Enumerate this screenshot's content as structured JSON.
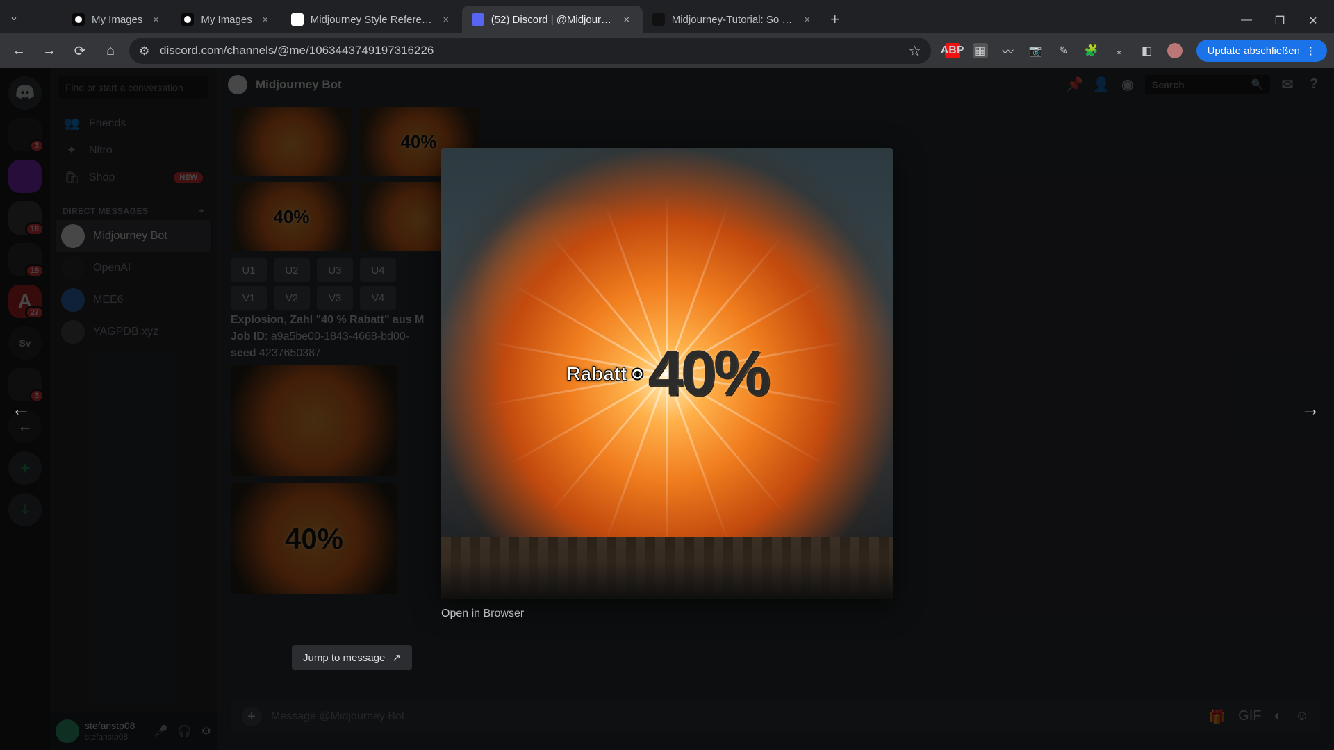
{
  "browser": {
    "tabs": [
      {
        "title": "My Images"
      },
      {
        "title": "My Images"
      },
      {
        "title": "Midjourney Style Reference"
      },
      {
        "title": "(52) Discord | @Midjourney Bot"
      },
      {
        "title": "Midjourney-Tutorial: So erstell"
      }
    ],
    "active_tab_index": 3,
    "url": "discord.com/channels/@me/1063443749197316226",
    "update_label": "Update abschließen"
  },
  "discord": {
    "dm_search_placeholder": "Find or start a conversation",
    "nav": {
      "friends": "Friends",
      "nitro": "Nitro",
      "shop": "Shop",
      "shop_badge": "NEW"
    },
    "dm_header": "DIRECT MESSAGES",
    "dms": [
      {
        "name": "Midjourney Bot"
      },
      {
        "name": "OpenAI"
      },
      {
        "name": "MEE6"
      },
      {
        "name": "YAGPDB.xyz"
      }
    ],
    "active_dm_index": 0,
    "user": {
      "name": "stefanstp08",
      "tag": "stefanstp08"
    },
    "chat": {
      "title": "Midjourney Bot",
      "search_placeholder": "Search",
      "upscale_row": [
        "U1",
        "U2",
        "U3",
        "U4"
      ],
      "variant_row": [
        "V1",
        "V2",
        "V3",
        "V4"
      ],
      "grid_labels": [
        "",
        "40%",
        "40%",
        ""
      ],
      "meta_prompt_b": "Explosion, Zahl \"40 % Rabatt\" aus M",
      "meta_jobid_k": "Job ID",
      "meta_jobid_v": "a9a5be00-1843-4668-bd00-",
      "meta_seed_k": "seed",
      "meta_seed_v": "4237650387",
      "thumb_label": "40%",
      "input_placeholder": "Message @Midjourney Bot"
    },
    "lightbox": {
      "rabatt": "Rabatt",
      "bubble": "◉",
      "forty": "40%",
      "open_link": "Open in Browser",
      "jump_label": "Jump to message"
    }
  }
}
